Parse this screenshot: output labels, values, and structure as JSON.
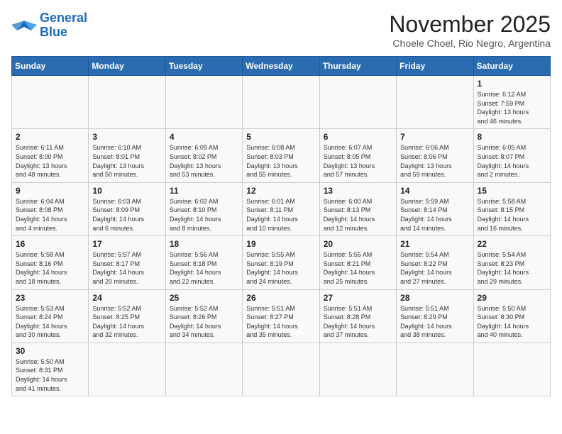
{
  "header": {
    "logo_general": "General",
    "logo_blue": "Blue",
    "month": "November 2025",
    "location": "Choele Choel, Rio Negro, Argentina"
  },
  "weekdays": [
    "Sunday",
    "Monday",
    "Tuesday",
    "Wednesday",
    "Thursday",
    "Friday",
    "Saturday"
  ],
  "weeks": [
    [
      {
        "day": "",
        "info": ""
      },
      {
        "day": "",
        "info": ""
      },
      {
        "day": "",
        "info": ""
      },
      {
        "day": "",
        "info": ""
      },
      {
        "day": "",
        "info": ""
      },
      {
        "day": "",
        "info": ""
      },
      {
        "day": "1",
        "info": "Sunrise: 6:12 AM\nSunset: 7:59 PM\nDaylight: 13 hours\nand 46 minutes."
      }
    ],
    [
      {
        "day": "2",
        "info": "Sunrise: 6:11 AM\nSunset: 8:00 PM\nDaylight: 13 hours\nand 48 minutes."
      },
      {
        "day": "3",
        "info": "Sunrise: 6:10 AM\nSunset: 8:01 PM\nDaylight: 13 hours\nand 50 minutes."
      },
      {
        "day": "4",
        "info": "Sunrise: 6:09 AM\nSunset: 8:02 PM\nDaylight: 13 hours\nand 53 minutes."
      },
      {
        "day": "5",
        "info": "Sunrise: 6:08 AM\nSunset: 8:03 PM\nDaylight: 13 hours\nand 55 minutes."
      },
      {
        "day": "6",
        "info": "Sunrise: 6:07 AM\nSunset: 8:05 PM\nDaylight: 13 hours\nand 57 minutes."
      },
      {
        "day": "7",
        "info": "Sunrise: 6:06 AM\nSunset: 8:06 PM\nDaylight: 13 hours\nand 59 minutes."
      },
      {
        "day": "8",
        "info": "Sunrise: 6:05 AM\nSunset: 8:07 PM\nDaylight: 14 hours\nand 2 minutes."
      }
    ],
    [
      {
        "day": "9",
        "info": "Sunrise: 6:04 AM\nSunset: 8:08 PM\nDaylight: 14 hours\nand 4 minutes."
      },
      {
        "day": "10",
        "info": "Sunrise: 6:03 AM\nSunset: 8:09 PM\nDaylight: 14 hours\nand 6 minutes."
      },
      {
        "day": "11",
        "info": "Sunrise: 6:02 AM\nSunset: 8:10 PM\nDaylight: 14 hours\nand 8 minutes."
      },
      {
        "day": "12",
        "info": "Sunrise: 6:01 AM\nSunset: 8:11 PM\nDaylight: 14 hours\nand 10 minutes."
      },
      {
        "day": "13",
        "info": "Sunrise: 6:00 AM\nSunset: 8:13 PM\nDaylight: 14 hours\nand 12 minutes."
      },
      {
        "day": "14",
        "info": "Sunrise: 5:59 AM\nSunset: 8:14 PM\nDaylight: 14 hours\nand 14 minutes."
      },
      {
        "day": "15",
        "info": "Sunrise: 5:58 AM\nSunset: 8:15 PM\nDaylight: 14 hours\nand 16 minutes."
      }
    ],
    [
      {
        "day": "16",
        "info": "Sunrise: 5:58 AM\nSunset: 8:16 PM\nDaylight: 14 hours\nand 18 minutes."
      },
      {
        "day": "17",
        "info": "Sunrise: 5:57 AM\nSunset: 8:17 PM\nDaylight: 14 hours\nand 20 minutes."
      },
      {
        "day": "18",
        "info": "Sunrise: 5:56 AM\nSunset: 8:18 PM\nDaylight: 14 hours\nand 22 minutes."
      },
      {
        "day": "19",
        "info": "Sunrise: 5:55 AM\nSunset: 8:19 PM\nDaylight: 14 hours\nand 24 minutes."
      },
      {
        "day": "20",
        "info": "Sunrise: 5:55 AM\nSunset: 8:21 PM\nDaylight: 14 hours\nand 25 minutes."
      },
      {
        "day": "21",
        "info": "Sunrise: 5:54 AM\nSunset: 8:22 PM\nDaylight: 14 hours\nand 27 minutes."
      },
      {
        "day": "22",
        "info": "Sunrise: 5:54 AM\nSunset: 8:23 PM\nDaylight: 14 hours\nand 29 minutes."
      }
    ],
    [
      {
        "day": "23",
        "info": "Sunrise: 5:53 AM\nSunset: 8:24 PM\nDaylight: 14 hours\nand 30 minutes."
      },
      {
        "day": "24",
        "info": "Sunrise: 5:52 AM\nSunset: 8:25 PM\nDaylight: 14 hours\nand 32 minutes."
      },
      {
        "day": "25",
        "info": "Sunrise: 5:52 AM\nSunset: 8:26 PM\nDaylight: 14 hours\nand 34 minutes."
      },
      {
        "day": "26",
        "info": "Sunrise: 5:51 AM\nSunset: 8:27 PM\nDaylight: 14 hours\nand 35 minutes."
      },
      {
        "day": "27",
        "info": "Sunrise: 5:51 AM\nSunset: 8:28 PM\nDaylight: 14 hours\nand 37 minutes."
      },
      {
        "day": "28",
        "info": "Sunrise: 5:51 AM\nSunset: 8:29 PM\nDaylight: 14 hours\nand 38 minutes."
      },
      {
        "day": "29",
        "info": "Sunrise: 5:50 AM\nSunset: 8:30 PM\nDaylight: 14 hours\nand 40 minutes."
      }
    ],
    [
      {
        "day": "30",
        "info": "Sunrise: 5:50 AM\nSunset: 8:31 PM\nDaylight: 14 hours\nand 41 minutes."
      },
      {
        "day": "",
        "info": ""
      },
      {
        "day": "",
        "info": ""
      },
      {
        "day": "",
        "info": ""
      },
      {
        "day": "",
        "info": ""
      },
      {
        "day": "",
        "info": ""
      },
      {
        "day": "",
        "info": ""
      }
    ]
  ]
}
